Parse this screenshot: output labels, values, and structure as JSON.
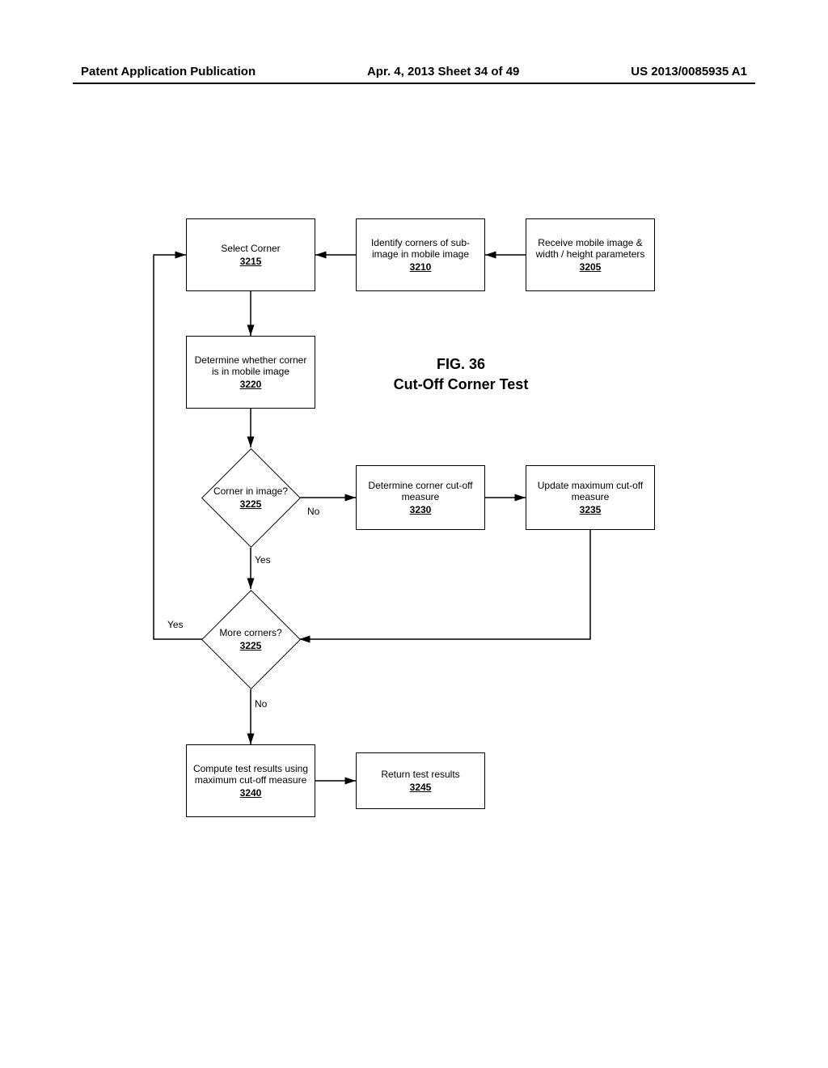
{
  "header": {
    "left": "Patent Application Publication",
    "center": "Apr. 4, 2013  Sheet 34 of 49",
    "right": "US 2013/0085935 A1"
  },
  "figure": {
    "number": "FIG. 36",
    "title": "Cut-Off Corner Test"
  },
  "chart_data": {
    "type": "flowchart",
    "nodes": [
      {
        "id": "3205",
        "type": "process",
        "text": "Receive mobile image & width / height parameters",
        "ref": "3205"
      },
      {
        "id": "3210",
        "type": "process",
        "text": "Identify corners of sub-image in mobile image",
        "ref": "3210"
      },
      {
        "id": "3215",
        "type": "process",
        "text": "Select Corner",
        "ref": "3215"
      },
      {
        "id": "3220",
        "type": "process",
        "text": "Determine whether corner is in mobile image",
        "ref": "3220"
      },
      {
        "id": "3225a",
        "type": "decision",
        "text": "Corner in image?",
        "ref": "3225"
      },
      {
        "id": "3230",
        "type": "process",
        "text": "Determine corner cut-off measure",
        "ref": "3230"
      },
      {
        "id": "3235",
        "type": "process",
        "text": "Update maximum cut-off measure",
        "ref": "3235"
      },
      {
        "id": "3225b",
        "type": "decision",
        "text": "More corners?",
        "ref": "3225"
      },
      {
        "id": "3240",
        "type": "process",
        "text": "Compute test results using maximum cut-off measure",
        "ref": "3240"
      },
      {
        "id": "3245",
        "type": "process",
        "text": "Return test results",
        "ref": "3245"
      }
    ],
    "edges": [
      {
        "from": "3205",
        "to": "3210"
      },
      {
        "from": "3210",
        "to": "3215"
      },
      {
        "from": "3215",
        "to": "3220"
      },
      {
        "from": "3220",
        "to": "3225a"
      },
      {
        "from": "3225a",
        "to": "3230",
        "label": "No"
      },
      {
        "from": "3230",
        "to": "3235"
      },
      {
        "from": "3225a",
        "to": "3225b",
        "label": "Yes"
      },
      {
        "from": "3235",
        "to": "3225b"
      },
      {
        "from": "3225b",
        "to": "3215",
        "label": "Yes"
      },
      {
        "from": "3225b",
        "to": "3240",
        "label": "No"
      },
      {
        "from": "3240",
        "to": "3245"
      }
    ]
  },
  "boxes": {
    "b3205": {
      "text": "Receive mobile image & width / height parameters",
      "ref": "3205"
    },
    "b3210": {
      "text": "Identify corners of sub-image in mobile image",
      "ref": "3210"
    },
    "b3215": {
      "text": "Select Corner",
      "ref": "3215"
    },
    "b3220": {
      "text": "Determine whether corner is in mobile image",
      "ref": "3220"
    },
    "b3225a": {
      "text": "Corner in image?",
      "ref": "3225"
    },
    "b3230": {
      "text": "Determine corner cut-off measure",
      "ref": "3230"
    },
    "b3235": {
      "text": "Update maximum cut-off measure",
      "ref": "3235"
    },
    "b3225b": {
      "text": "More corners?",
      "ref": "3225"
    },
    "b3240": {
      "text": "Compute test results using maximum cut-off measure",
      "ref": "3240"
    },
    "b3245": {
      "text": "Return test results",
      "ref": "3245"
    }
  },
  "labels": {
    "no1": "No",
    "yes1": "Yes",
    "yes2": "Yes",
    "no2": "No"
  }
}
